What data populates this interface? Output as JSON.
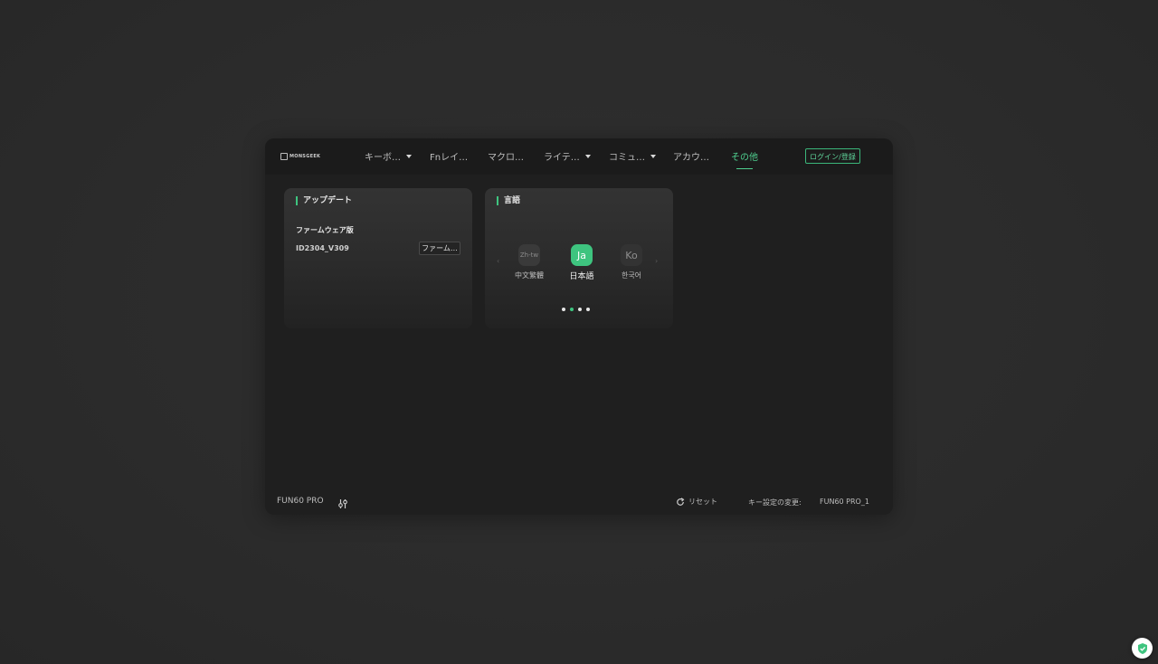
{
  "brand": {
    "logo_text": "MONSGEEK"
  },
  "nav": {
    "items": [
      {
        "label": "キーボ…",
        "has_dropdown": true
      },
      {
        "label": "Fnレイ…",
        "has_dropdown": false
      },
      {
        "label": "マクロ…",
        "has_dropdown": false
      },
      {
        "label": "ライテ…",
        "has_dropdown": true
      },
      {
        "label": "コミュ…",
        "has_dropdown": true
      },
      {
        "label": "アカウ…",
        "has_dropdown": false
      },
      {
        "label": "その他",
        "has_dropdown": false,
        "active": true
      }
    ],
    "login_label": "ログイン/登録"
  },
  "update_card": {
    "title": "アップデート",
    "firmware_label": "ファームウェア版",
    "firmware_version": "ID2304_V309",
    "firmware_button": "ファーム…"
  },
  "language_card": {
    "title": "言語",
    "languages": [
      {
        "code": "Zh-tw",
        "name": "中文繁體",
        "selected": false
      },
      {
        "code": "Ja",
        "name": "日本語",
        "selected": true
      },
      {
        "code": "Ko",
        "name": "한국어",
        "selected": false
      }
    ],
    "prev_arrow": "‹",
    "next_arrow": "›",
    "page_count": 4,
    "active_page": 2
  },
  "footer": {
    "device_name": "FUN60 PRO",
    "reset_label": "リセット",
    "key_config_label": "キー設定の変更:",
    "profile_name": "FUN60 PRO_1"
  },
  "colors": {
    "accent": "#3ec47f",
    "background": "#2b2b2b",
    "panel": "#1f1f1f",
    "card": "#2f2f2f"
  },
  "icons": {
    "settings": "sliders-icon",
    "reset": "refresh-icon",
    "security": "shield-check-icon"
  }
}
